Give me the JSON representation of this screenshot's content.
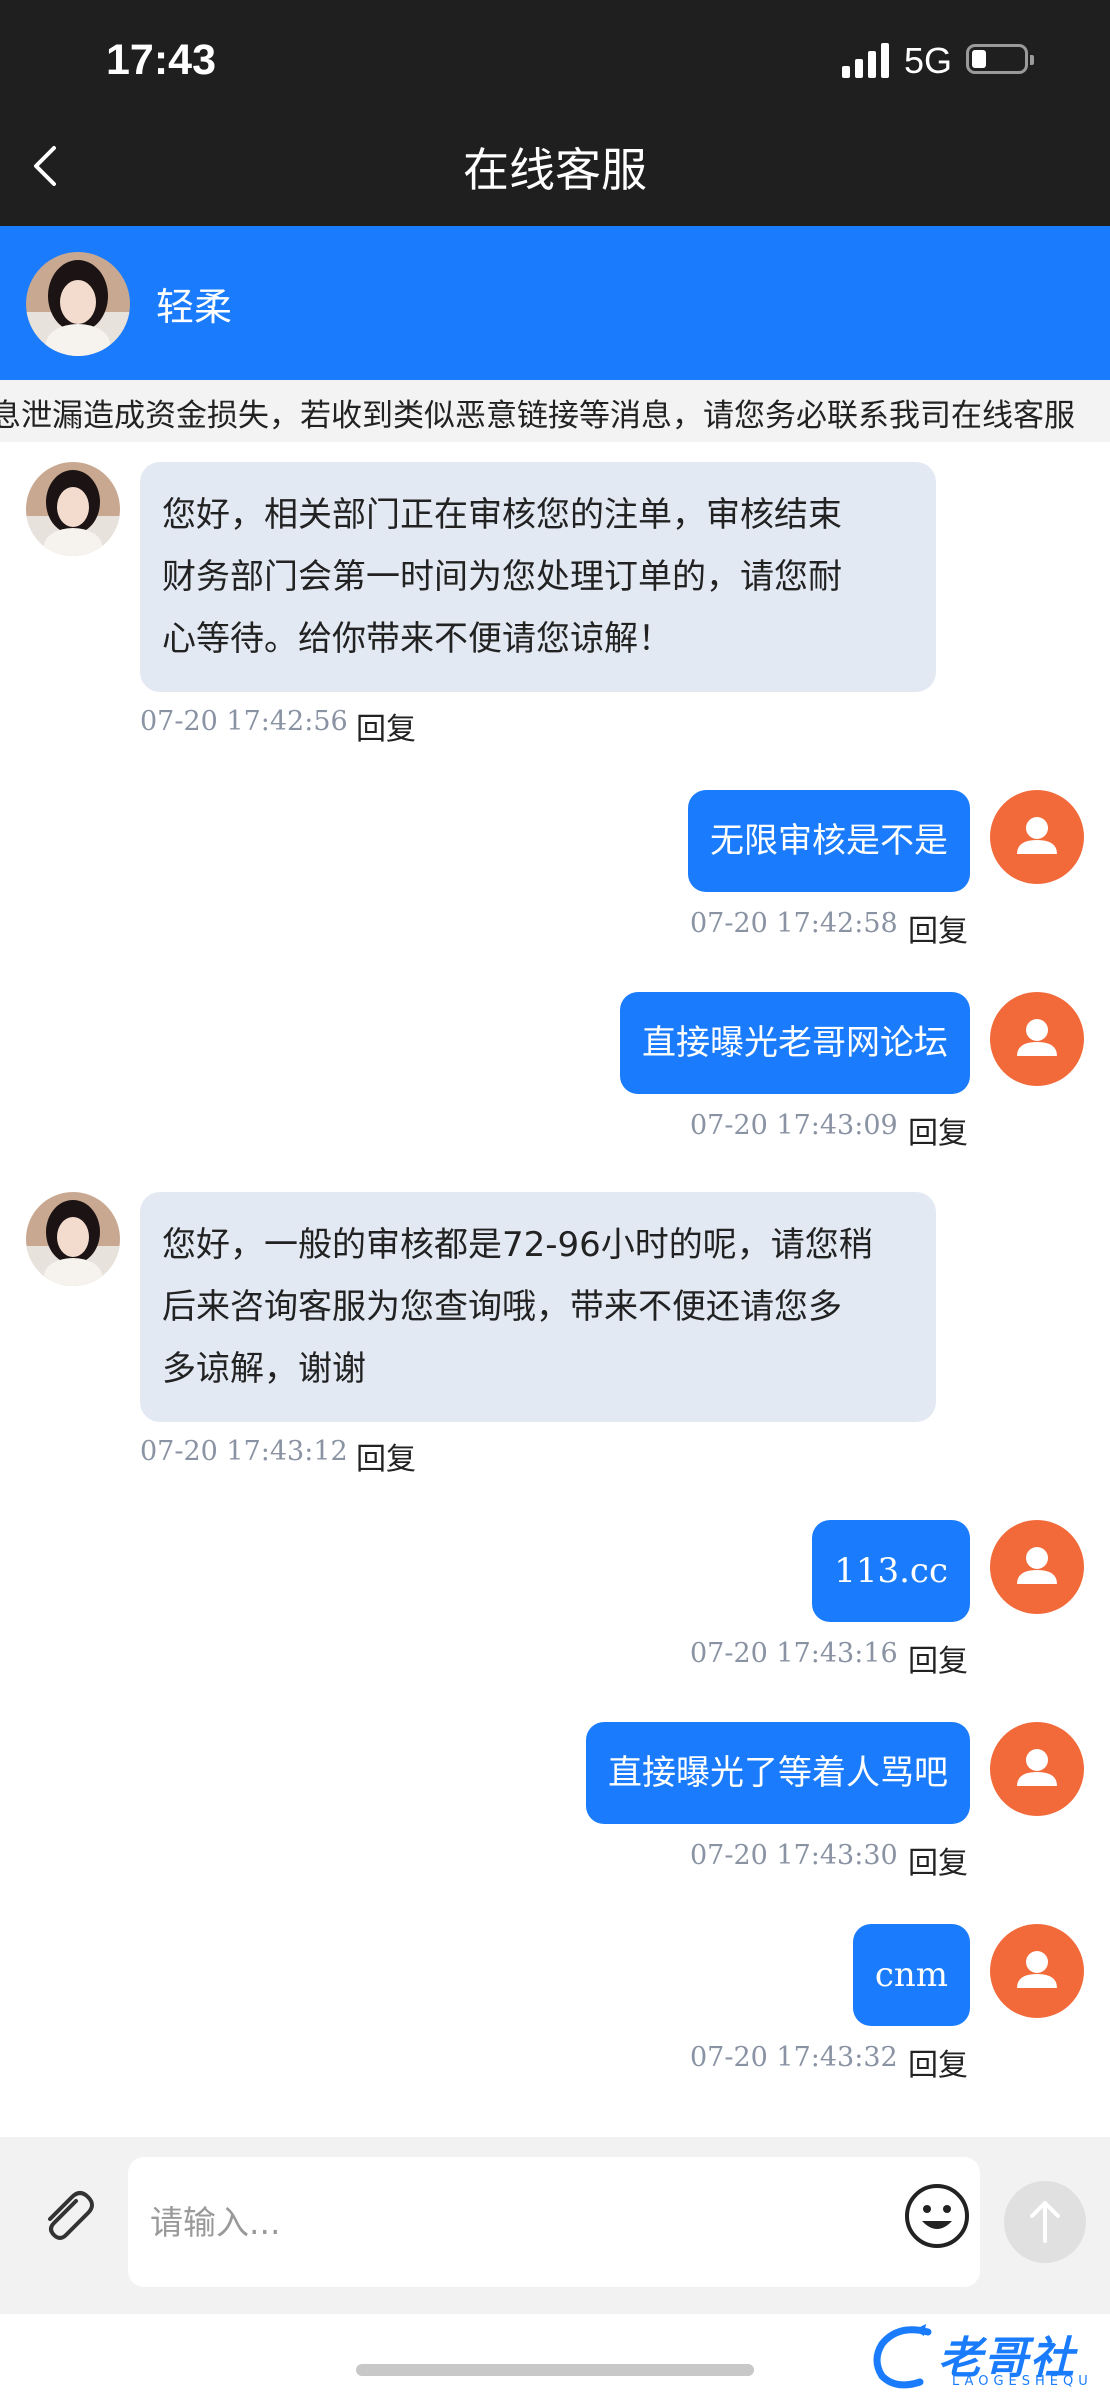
{
  "status_bar": {
    "time": "17:43",
    "network": "5G"
  },
  "nav": {
    "title": "在线客服"
  },
  "agent": {
    "name": "轻柔"
  },
  "notice": {
    "text": "息泄漏造成资金损失，若收到类似恶意链接等消息，请您务必联系我司在线客服"
  },
  "messages": [
    {
      "side": "in",
      "lines": [
        "您好，相关部门正在审核您的注单，审核结束",
        "财务部门会第一时间为您处理订单的，请您耐",
        "心等待。给你带来不便请您谅解！"
      ],
      "time": "07-20 17:42:56",
      "reply": "回复"
    },
    {
      "side": "out",
      "text": "无限审核是不是",
      "time": "07-20 17:42:58",
      "reply": "回复"
    },
    {
      "side": "out",
      "text": "直接曝光老哥网论坛",
      "time": "07-20 17:43:09",
      "reply": "回复"
    },
    {
      "side": "in",
      "lines": [
        "您好，一般的审核都是72-96小时的呢，请您稍",
        "后来咨询客服为您查询哦，带来不便还请您多",
        "多谅解，谢谢"
      ],
      "time": "07-20 17:43:12",
      "reply": "回复"
    },
    {
      "side": "out",
      "text": "113.cc",
      "time": "07-20 17:43:16",
      "reply": "回复"
    },
    {
      "side": "out",
      "text": "直接曝光了等着人骂吧",
      "time": "07-20 17:43:30",
      "reply": "回复"
    },
    {
      "side": "out",
      "text": "cnm",
      "time": "07-20 17:43:32",
      "reply": "回复"
    }
  ],
  "composer": {
    "placeholder": "请输入..."
  },
  "watermark": {
    "text": "老哥社区",
    "sub": "LAOGESHEQU"
  },
  "colors": {
    "accent": "#1a7cfc",
    "user_avatar": "#f26a3a",
    "incoming_bubble": "#e3e9f3",
    "topbar": "#1f1f1f"
  }
}
